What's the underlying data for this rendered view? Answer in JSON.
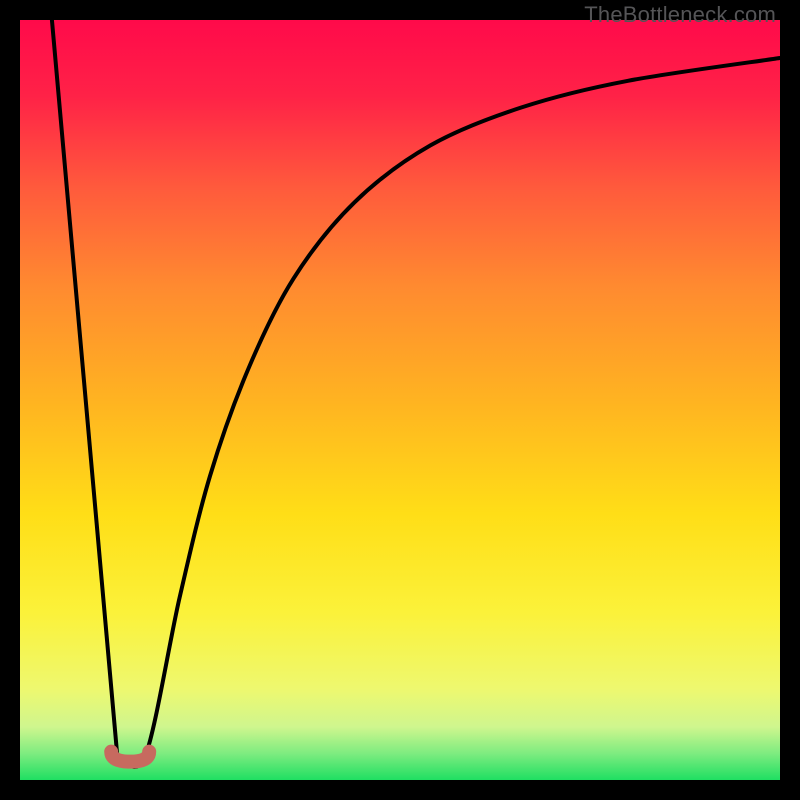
{
  "watermark": "TheBottleneck.com",
  "chart_data": {
    "type": "line",
    "title": "",
    "xlabel": "",
    "ylabel": "",
    "xlim": [
      0,
      100
    ],
    "ylim": [
      0,
      100
    ],
    "grid": false,
    "series": [
      {
        "name": "curve",
        "data": [
          {
            "x": 4.2,
            "y": 100.0
          },
          {
            "x": 12.8,
            "y": 3.2
          },
          {
            "x": 16.5,
            "y": 3.2
          },
          {
            "x": 21.0,
            "y": 24.0
          },
          {
            "x": 25.0,
            "y": 40.0
          },
          {
            "x": 30.0,
            "y": 54.0
          },
          {
            "x": 36.0,
            "y": 66.0
          },
          {
            "x": 44.0,
            "y": 76.0
          },
          {
            "x": 54.0,
            "y": 83.5
          },
          {
            "x": 66.0,
            "y": 88.5
          },
          {
            "x": 80.0,
            "y": 92.0
          },
          {
            "x": 100.0,
            "y": 95.0
          }
        ]
      }
    ],
    "minimum_marker": {
      "x_start": 12.0,
      "x_end": 17.0,
      "y": 3.2
    },
    "gradient_stops": [
      {
        "offset": 0.0,
        "color": "#ff0a4a"
      },
      {
        "offset": 0.1,
        "color": "#ff2247"
      },
      {
        "offset": 0.22,
        "color": "#ff5a3c"
      },
      {
        "offset": 0.35,
        "color": "#ff8a30"
      },
      {
        "offset": 0.5,
        "color": "#ffb321"
      },
      {
        "offset": 0.65,
        "color": "#ffde17"
      },
      {
        "offset": 0.78,
        "color": "#fbf23a"
      },
      {
        "offset": 0.88,
        "color": "#eef86f"
      },
      {
        "offset": 0.93,
        "color": "#cff68e"
      },
      {
        "offset": 0.965,
        "color": "#7eec80"
      },
      {
        "offset": 1.0,
        "color": "#1fdf62"
      }
    ]
  }
}
